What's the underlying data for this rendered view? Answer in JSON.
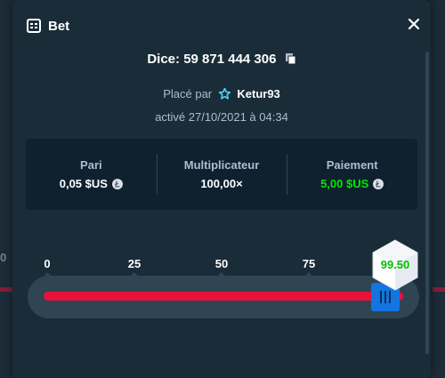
{
  "modal": {
    "title": "Bet",
    "dice_id": "Dice: 59 871 444 306",
    "placed_by_prefix": "Placé par",
    "username": "Ketur93",
    "activated": "activé 27/10/2021 à 04:34"
  },
  "stats": {
    "bet": {
      "label": "Pari",
      "value": "0,05 $US"
    },
    "multiplier": {
      "label": "Multiplicateur",
      "value": "100,00×"
    },
    "payout": {
      "label": "Paiement",
      "value": "5,00 $US"
    }
  },
  "slider": {
    "ticks": [
      "0",
      "25",
      "50",
      "75"
    ],
    "target": 99.5,
    "result_label": "99.50"
  },
  "background": {
    "zero_label": "0"
  },
  "colors": {
    "accent_blue": "#1475e1",
    "lose_red": "#e9113c",
    "win_green": "#00e701",
    "panel": "#1a2c38",
    "dark": "#0f212e"
  },
  "icons": [
    "bet-icon",
    "close-icon",
    "copy-icon",
    "vip-star-icon",
    "litecoin-icon"
  ]
}
